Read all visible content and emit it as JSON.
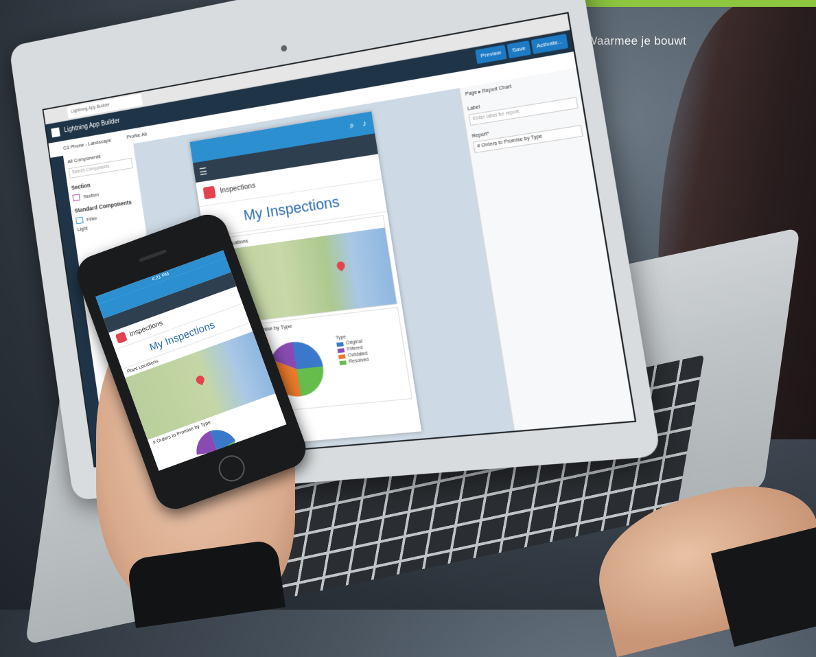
{
  "chapter_title": "HOOFDSTUK 3: Waarmee je bouwt",
  "colors": {
    "accent_green": "#8dc63f",
    "salesforce_blue": "#2b8fd0",
    "nav_dark": "#2e3f4f",
    "inspection_red": "#e2434e"
  },
  "laptop": {
    "browser_tab": "Lightning App Builder",
    "app_title": "Lightning App Builder",
    "toolbar": {
      "device": "C3 Phone - Landscape",
      "profile": "Profile All"
    },
    "buttons": [
      "Preview",
      "Save",
      "Activate..."
    ],
    "left_panel": {
      "title": "All Components",
      "search_placeholder": "Search Components",
      "section_heading": "Section",
      "section_item": "Section",
      "standard_heading": "Standard Components",
      "standard_items": [
        "Filter",
        "Light"
      ]
    },
    "canvas": {
      "object_label": "Inspections",
      "page_title": "My Inspections",
      "map_card": "Plant Locations",
      "chart_card": "# Orders to Promise by Type",
      "legend_title": "Type",
      "legend": [
        "Original",
        "Filtered",
        "Outdated",
        "Resolved"
      ]
    },
    "right_panel": {
      "breadcrumb": "Page  ▸  Report Chart",
      "label_field": "Label",
      "label_placeholder": "Enter label for report",
      "report_field": "Report*",
      "report_value": "# Orders to Promise by Type"
    }
  },
  "phone": {
    "time": "4:21 PM",
    "object_label": "Inspections",
    "page_title": "My Inspections",
    "map_card": "Plant Locations",
    "chart_card": "# Orders to Promise by Type"
  }
}
